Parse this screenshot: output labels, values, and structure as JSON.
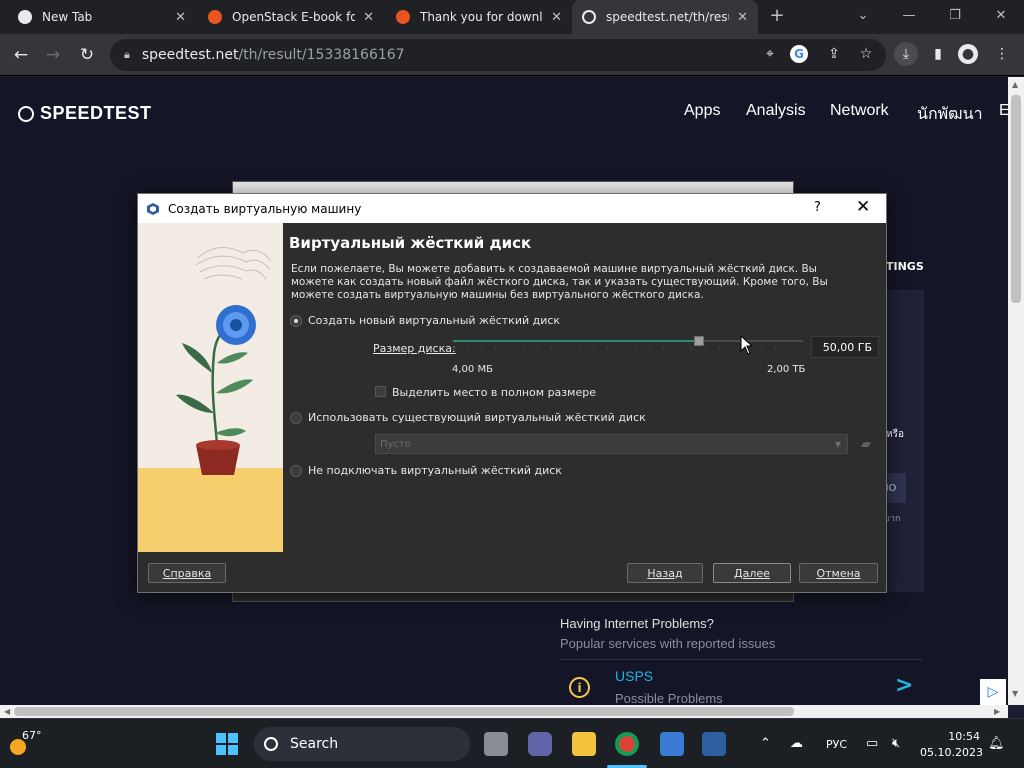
{
  "browser": {
    "tabs": [
      {
        "title": "New Tab",
        "active": false
      },
      {
        "title": "OpenStack E-book for",
        "active": false
      },
      {
        "title": "Thank you for downlo",
        "active": false
      },
      {
        "title": "speedtest.net/th/resul",
        "active": true
      }
    ],
    "new_tab": "+",
    "url_host": "speedtest.net",
    "url_path": "/th/result/15338166167"
  },
  "page": {
    "logo": "SPEEDTEST",
    "nav": [
      "Apps",
      "Analysis",
      "Network",
      "นักพัฒนา",
      "E"
    ],
    "settings_label": "TINGS",
    "right_card_text": "หรือ",
    "right_card_box": "IO",
    "right_card_small": "มาก",
    "problems_title": "Having Internet Problems?",
    "problems_subtitle": "Popular services with reported issues",
    "service_name": "USPS",
    "service_status": "Possible Problems"
  },
  "dialog": {
    "title": "Создать виртуальную машину",
    "help_glyph": "?",
    "close_glyph": "✕",
    "heading": "Виртуальный жёсткий диск",
    "description": "Если пожелаете, Вы можете добавить к создаваемой машине виртуальный жёсткий диск. Вы можете как создать новый файл жёсткого диска, так и указать существующий. Кроме того, Вы можете создать виртуальную машины без виртуального жёсткого диска.",
    "option_create": "Создать новый виртуальный жёсткий диск",
    "size_label": "Размер диска:",
    "size_value": "50,00 ГБ",
    "size_fraction": 0.7,
    "size_min": "4,00 МБ",
    "size_max": "2,00 ТБ",
    "preallocate": "Выделить место в полном размере",
    "option_existing": "Использовать существующий виртуальный жёсткий диск",
    "existing_placeholder": "Пусто",
    "option_none": "Не подключать виртуальный жёсткий диск",
    "btn_help": "Справка",
    "btn_back": "Назад",
    "btn_next": "Далее",
    "btn_cancel": "Отмена"
  },
  "taskbar": {
    "temperature": "67°",
    "search": "Search",
    "language": "РУС",
    "time": "10:54",
    "date": "05.10.2023"
  },
  "colors": {
    "page_bg": "#141526",
    "accent_cyan": "#1fb5e0",
    "slider_fill": "#2f8a7a"
  }
}
